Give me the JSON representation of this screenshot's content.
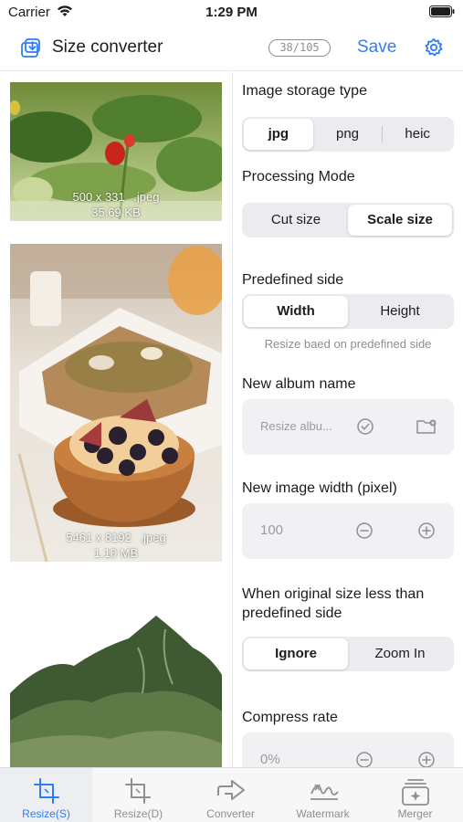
{
  "status_bar": {
    "carrier": "Carrier",
    "time": "1:29 PM"
  },
  "nav": {
    "title": "Size converter",
    "counter": "38/105",
    "save_label": "Save"
  },
  "images": [
    {
      "dimensions": "500 x 331",
      "format": ".jpeg",
      "size": "35.69 KB"
    },
    {
      "dimensions": "5461 x 8192",
      "format": ".jpeg",
      "size": "1.10 MB"
    },
    {
      "dimensions": "",
      "format": "",
      "size": ""
    }
  ],
  "settings": {
    "storage_type": {
      "label": "Image storage type",
      "options": [
        "jpg",
        "png",
        "heic"
      ],
      "selected": "jpg"
    },
    "processing_mode": {
      "label": "Processing Mode",
      "options": [
        "Cut size",
        "Scale size"
      ],
      "selected": "Scale size"
    },
    "predefined_side": {
      "label": "Predefined side",
      "options": [
        "Width",
        "Height"
      ],
      "selected": "Width",
      "hint": "Resize baed on predefined side"
    },
    "album": {
      "label": "New album name",
      "placeholder": "Resize albu..."
    },
    "width": {
      "label": "New image width (pixel)",
      "value": "100"
    },
    "less_than": {
      "label_line1": "When original size less than",
      "label_line2": "predefined side",
      "options": [
        "Ignore",
        "Zoom In"
      ],
      "selected": "Ignore"
    },
    "compress": {
      "label": "Compress rate",
      "value": "0%"
    }
  },
  "tabs": [
    {
      "label": "Resize(S)",
      "icon": "crop-icon",
      "active": true
    },
    {
      "label": "Resize(D)",
      "icon": "crop-icon",
      "active": false
    },
    {
      "label": "Converter",
      "icon": "arrow-right-icon",
      "active": false
    },
    {
      "label": "Watermark",
      "icon": "signature-icon",
      "active": false
    },
    {
      "label": "Merger",
      "icon": "merge-icon",
      "active": false
    }
  ],
  "colors": {
    "accent": "#2f7df6",
    "secondary_text": "#8e8e93"
  }
}
